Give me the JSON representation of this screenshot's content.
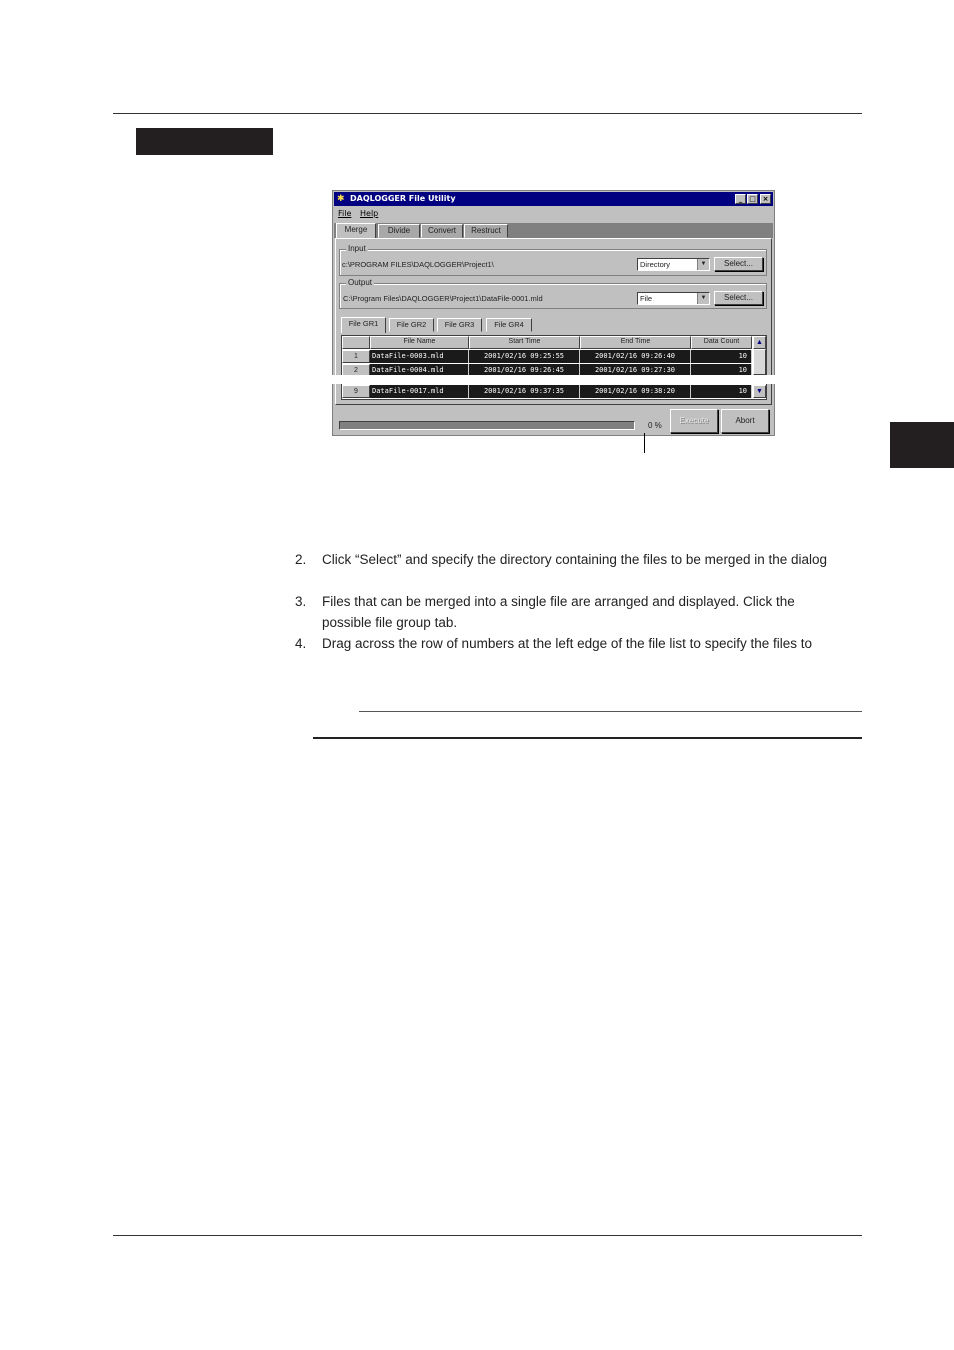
{
  "window": {
    "title": "DAQLOGGER File Utility",
    "controls": [
      "_",
      "□",
      "×"
    ],
    "menu": [
      "File",
      "Help"
    ],
    "tabs": [
      "Merge",
      "Divide",
      "Convert",
      "Restruct"
    ],
    "input": {
      "label": "Input",
      "path": "c:\\PROGRAM FILES\\DAQLOGGER\\Project1\\",
      "mode": "Directory",
      "select_label": "Select..."
    },
    "output": {
      "label": "Output",
      "path": "C:\\Program Files\\DAQLOGGER\\Project1\\DataFile-0001.mld",
      "mode": "File",
      "select_label": "Select..."
    },
    "groups": [
      "File GR1",
      "File GR2",
      "File GR3",
      "File GR4"
    ],
    "table": {
      "columns": [
        "File Name",
        "Start Time",
        "End Time",
        "Data Count"
      ],
      "rows": [
        {
          "num": "1",
          "file": "DataFile-0003.mld",
          "start": "2001/02/16 09:25:55",
          "end": "2001/02/16 09:26:40",
          "count": "10"
        },
        {
          "num": "2",
          "file": "DataFile-0004.mld",
          "start": "2001/02/16 09:26:45",
          "end": "2001/02/16 09:27:30",
          "count": "10"
        },
        {
          "num": "9",
          "file": "DataFile-0017.mld",
          "start": "2001/02/16 09:37:35",
          "end": "2001/02/16 09:38:20",
          "count": "10"
        }
      ]
    },
    "progress": {
      "percent_text": "0 %",
      "value": 0
    },
    "execute_label": "Execute",
    "abort_label": "Abort",
    "scroll_up": "▲",
    "scroll_down": "▼"
  },
  "steps": [
    {
      "num": "2.",
      "lines": [
        "Click “Select” and specify the directory containing the files to be merged in the dialog"
      ]
    },
    {
      "num": "3.",
      "lines": [
        "Files that can be merged into a single file are arranged and displayed.  Click the",
        "possible file group tab."
      ]
    },
    {
      "num": "4.",
      "lines": [
        "Drag across the row of numbers at the left edge of the file list to specify the files to"
      ]
    }
  ]
}
